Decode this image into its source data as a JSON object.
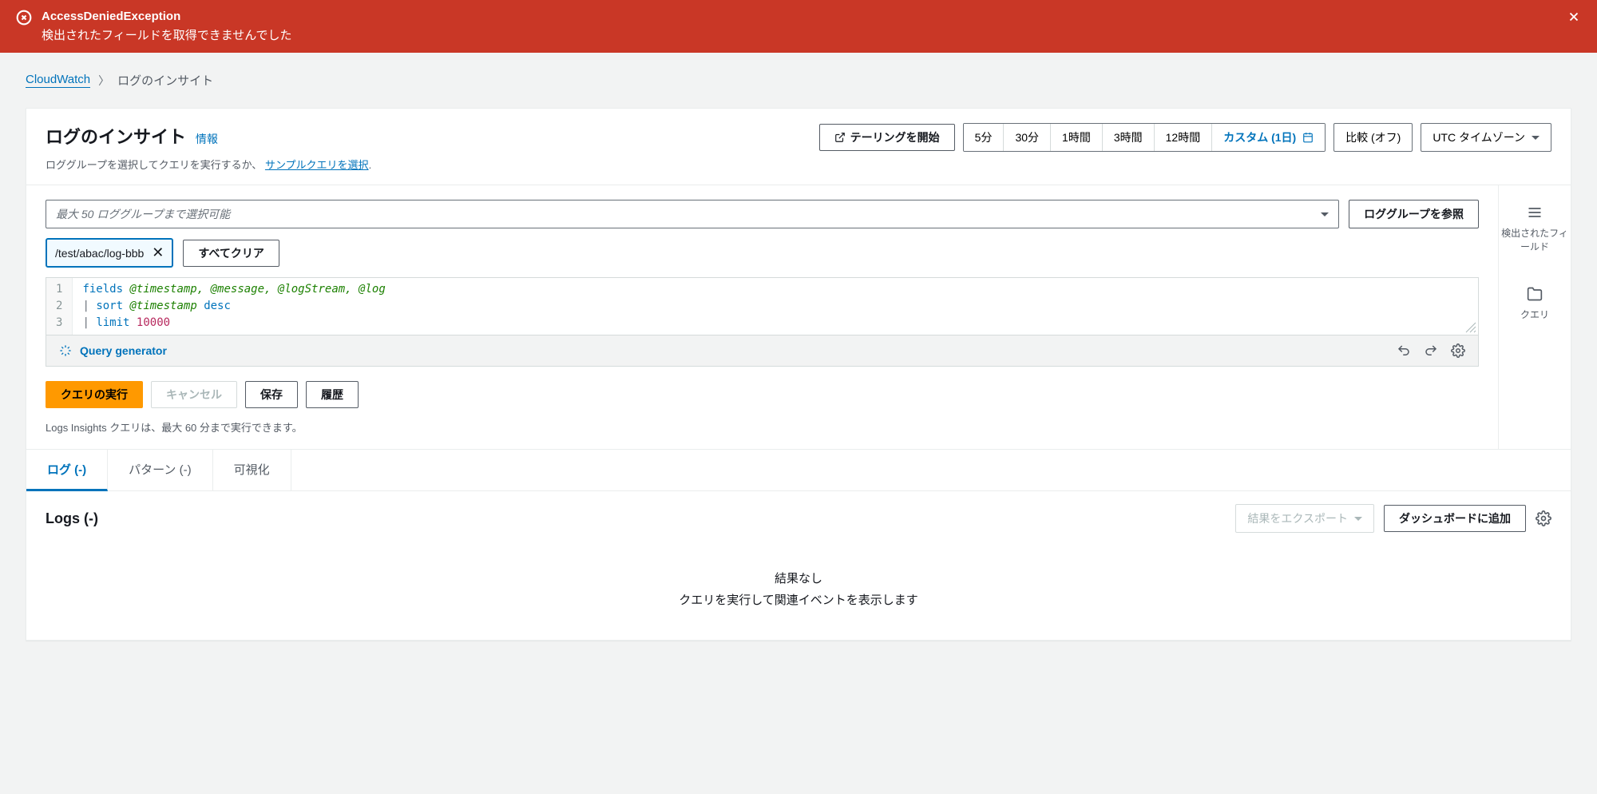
{
  "error": {
    "title": "AccessDeniedException",
    "message": "検出されたフィールドを取得できませんでした"
  },
  "breadcrumb": {
    "root": "CloudWatch",
    "current": "ログのインサイト"
  },
  "header": {
    "title": "ログのインサイト",
    "info": "情報",
    "subtitle_prefix": "ロググループを選択してクエリを実行するか、",
    "subtitle_link": "サンプルクエリを選択",
    "subtitle_suffix": "."
  },
  "toolbar": {
    "start_tailing": "テーリングを開始",
    "time_options": [
      "5分",
      "30分",
      "1時間",
      "3時間",
      "12時間"
    ],
    "time_custom": "カスタム (1日)",
    "compare": "比較 (オフ)",
    "timezone": "UTC タイムゾーン"
  },
  "log_group": {
    "placeholder": "最大 50 ロググループまで選択可能",
    "browse": "ロググループを参照",
    "selected": "/test/abac/log-bbb",
    "clear_all": "すべてクリア"
  },
  "editor": {
    "lines": [
      "1",
      "2",
      "3"
    ],
    "line1_kw": "fields",
    "line1_rest": "@timestamp, @message, @logStream, @log",
    "line2_pipe": "|",
    "line2_kw": "sort",
    "line2_fld": "@timestamp",
    "line2_dir": "desc",
    "line3_pipe": "|",
    "line3_kw": "limit",
    "line3_num": "10000"
  },
  "query_gen": "Query generator",
  "actions": {
    "run": "クエリの実行",
    "cancel": "キャンセル",
    "save": "保存",
    "history": "履歴"
  },
  "hint": "Logs Insights クエリは、最大 60 分まで実行できます。",
  "tabs": {
    "logs": "ログ (-)",
    "patterns": "パターン (-)",
    "visualize": "可視化"
  },
  "results": {
    "title": "Logs (-)",
    "export": "結果をエクスポート",
    "add_dashboard": "ダッシュボードに追加",
    "empty_title": "結果なし",
    "empty_desc": "クエリを実行して関連イベントを表示します"
  },
  "sidebar": {
    "fields": "検出されたフィールド",
    "queries": "クエリ"
  }
}
